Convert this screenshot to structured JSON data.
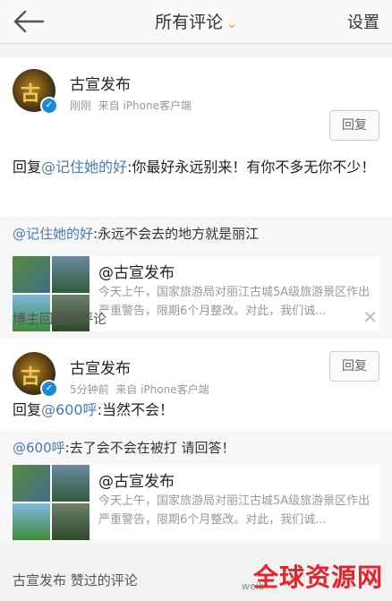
{
  "nav": {
    "title": "所有评论",
    "settings": "设置"
  },
  "comments": [
    {
      "name": "古宣发布",
      "time": "刚刚",
      "source": "来自 iPhone客户端",
      "reply_label": "回复",
      "reply_prefix": "回复",
      "reply_mention": "@记住她的好",
      "reply_text": ":你最好永远别来！有你不多无你不少！",
      "quote_mention": "@记住她的好",
      "quote_text": ":永远不会去的地方就是丽江",
      "repost_name": "@古宣发布",
      "repost_text": "今天上午，国家旅游局对丽江古城5A级旅游景区作出严重警告，限期6个月整改。对此，我们诚..."
    },
    {
      "name": "古宣发布",
      "time": "5分钟前",
      "source": "来自 iPhone客户端",
      "reply_label": "回复",
      "reply_prefix": "回复",
      "reply_mention": "@600呼",
      "reply_text": ":当然不会！",
      "quote_mention": "@600呼",
      "quote_text": ":去了会不会在被打 请回答！",
      "repost_name": "@古宣发布",
      "repost_text": "今天上午，国家旅游局对丽江古城5A级旅游景区作出严重警告，限期6个月整改。对此，我们诚..."
    }
  ],
  "sections": {
    "blogger_replies": "博主回复的评论",
    "liked": "古宣发布 赞过的评论"
  },
  "watermark": {
    "text": "全球资源网",
    "small": "weib"
  }
}
